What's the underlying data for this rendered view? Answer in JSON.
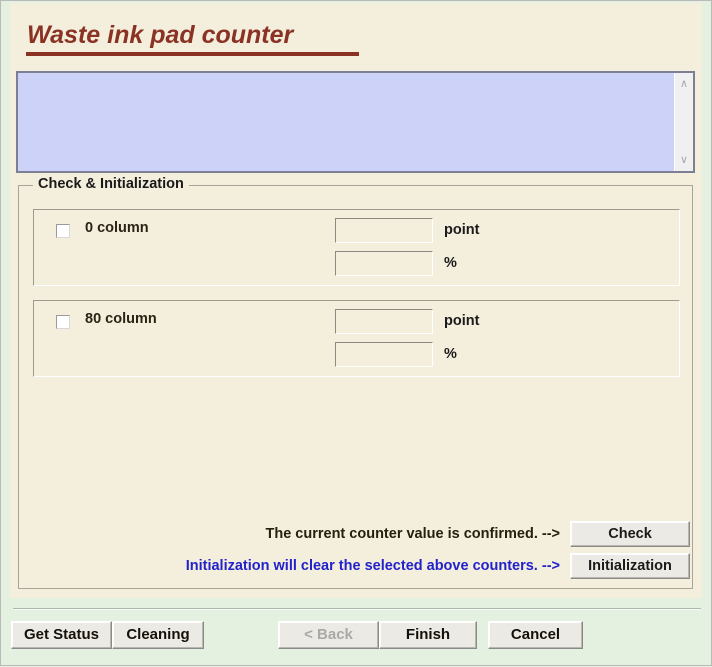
{
  "window": {
    "background_color": "#e4f0e0",
    "panel_color": "#f4eedc"
  },
  "header": {
    "title": "Waste ink pad counter",
    "title_color": "#8a3324"
  },
  "log_area": {
    "value": "",
    "placeholder": "",
    "background_color": "#ccd2f8",
    "scroll_up_icon": "scroll-up-arrow",
    "scroll_up_glyph": "∧",
    "scroll_down_icon": "scroll-down-arrow",
    "scroll_down_glyph": "∨"
  },
  "group": {
    "legend": "Check & Initialization",
    "counters": [
      {
        "label": "0 column",
        "checked": false,
        "point_value": "",
        "point_unit": "point",
        "percent_value": "",
        "percent_unit": "%"
      },
      {
        "label": "80 column",
        "checked": false,
        "point_value": "",
        "point_unit": "point",
        "percent_value": "",
        "percent_unit": "%"
      }
    ],
    "actions": [
      {
        "text": "The current counter value is confirmed. -->",
        "text_color": "#26210f",
        "button_label": "Check"
      },
      {
        "text": "Initialization will clear the selected above counters. -->",
        "text_color": "#2222cc",
        "button_label": "Initialization"
      }
    ]
  },
  "footer": {
    "buttons": [
      {
        "label": "Get Status",
        "disabled": false
      },
      {
        "label": "Cleaning",
        "disabled": false
      },
      {
        "label": "< Back",
        "disabled": true
      },
      {
        "label": "Finish",
        "disabled": false
      },
      {
        "label": "Cancel",
        "disabled": false
      }
    ]
  }
}
